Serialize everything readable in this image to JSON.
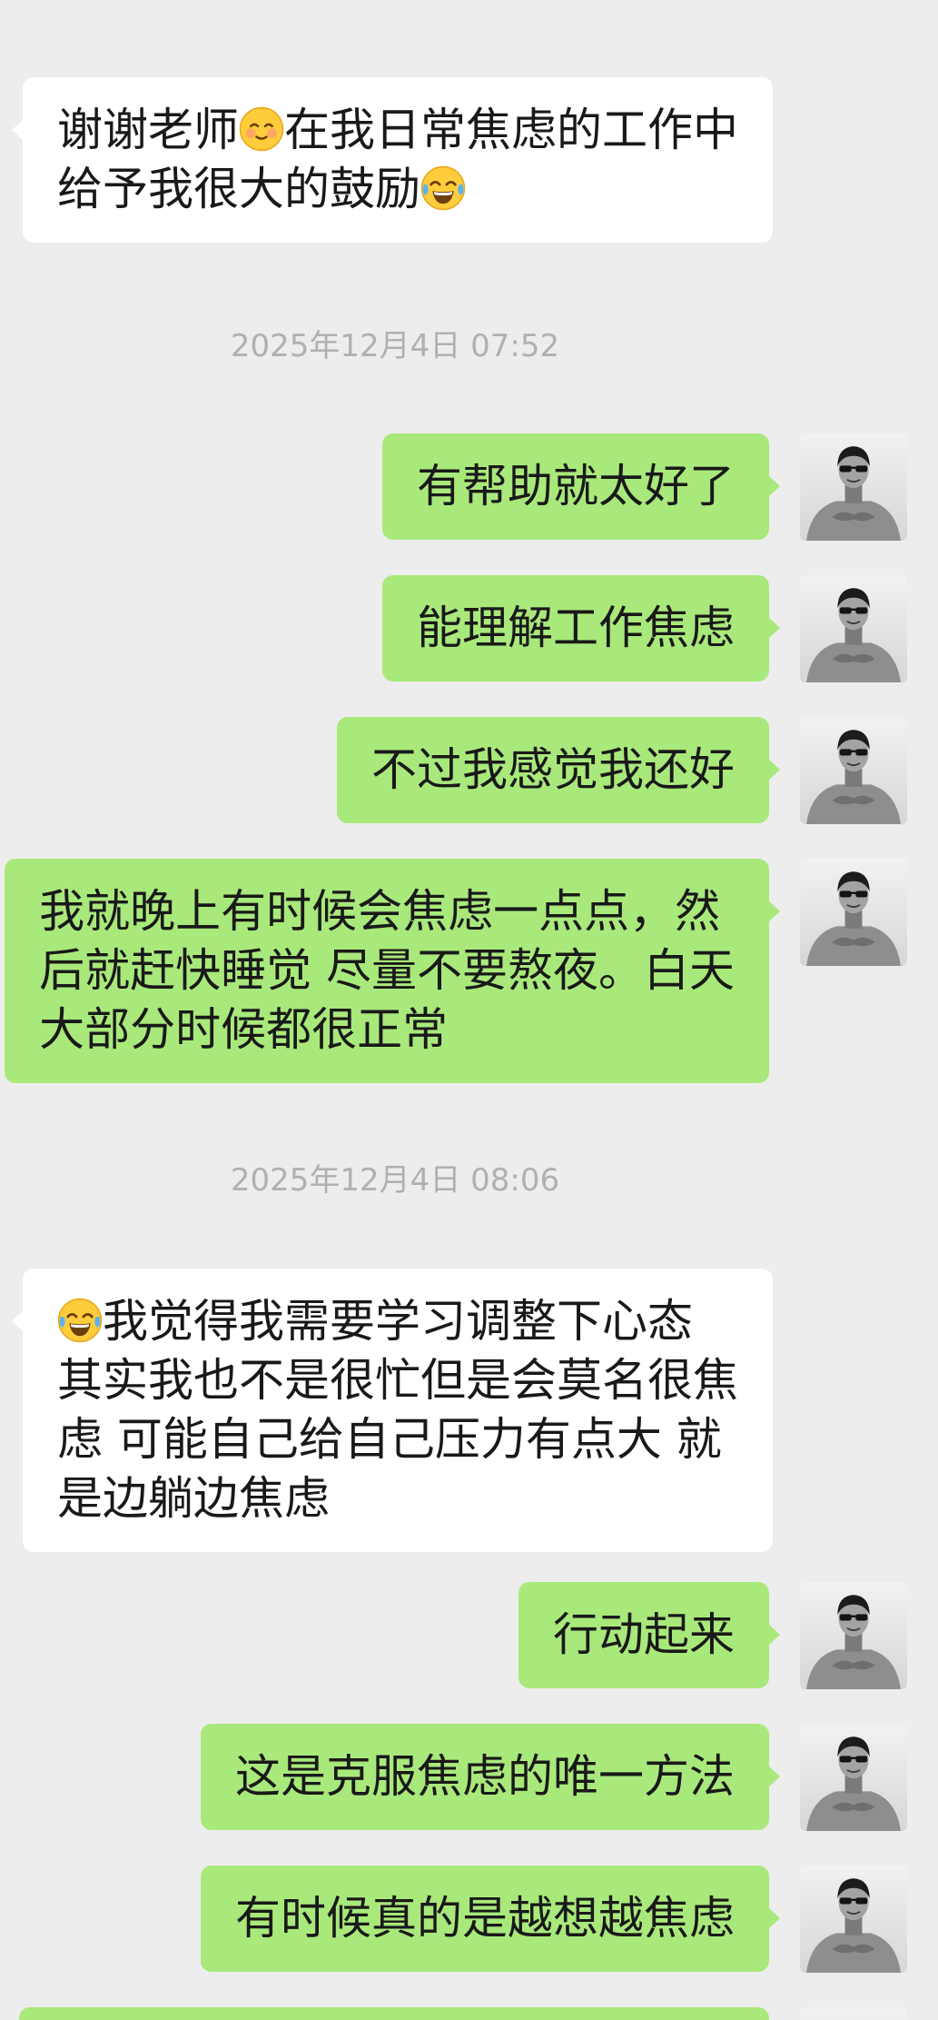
{
  "colors": {
    "background": "#ededed",
    "sent_bubble": "#a9e97b",
    "received_bubble": "#ffffff",
    "timestamp": "#b0b0b0",
    "text": "#191919"
  },
  "sent_avatar_icon": "profile-photo-icon",
  "items": [
    {
      "type": "message",
      "side": "received",
      "lines": [
        [
          "谢谢老师",
          {
            "icon": "smiling-face-icon"
          },
          "在我日常焦虑的工作中"
        ],
        [
          "给予我很大的鼓励",
          {
            "icon": "tears-of-joy-icon"
          }
        ]
      ]
    },
    {
      "type": "timestamp",
      "text": "2025年12月4日 07:52"
    },
    {
      "type": "message",
      "side": "sent",
      "lines": [
        [
          "有帮助就太好了"
        ]
      ]
    },
    {
      "type": "message",
      "side": "sent",
      "lines": [
        [
          "能理解工作焦虑"
        ]
      ]
    },
    {
      "type": "message",
      "side": "sent",
      "lines": [
        [
          "不过我感觉我还好"
        ]
      ]
    },
    {
      "type": "message",
      "side": "sent",
      "lines": [
        [
          "我就晚上有时候会焦虑一点点，然"
        ],
        [
          "后就赶快睡觉 尽量不要熬夜。白天"
        ],
        [
          "大部分时候都很正常"
        ]
      ]
    },
    {
      "type": "timestamp",
      "text": "2025年12月4日 08:06"
    },
    {
      "type": "message",
      "side": "received",
      "lines": [
        [
          {
            "icon": "tears-of-joy-icon"
          },
          "我觉得我需要学习调整下心态"
        ],
        [
          "其实我也不是很忙但是会莫名很焦"
        ],
        [
          "虑 可能自己给自己压力有点大 就"
        ],
        [
          "是边躺边焦虑"
        ]
      ]
    },
    {
      "type": "message",
      "side": "sent",
      "lines": [
        [
          "行动起来"
        ]
      ]
    },
    {
      "type": "message",
      "side": "sent",
      "lines": [
        [
          "这是克服焦虑的唯一方法"
        ]
      ]
    },
    {
      "type": "message",
      "side": "sent",
      "lines": [
        [
          "有时候真的是越想越焦虑"
        ]
      ]
    },
    {
      "type": "message",
      "side": "sent",
      "lines": []
    }
  ]
}
